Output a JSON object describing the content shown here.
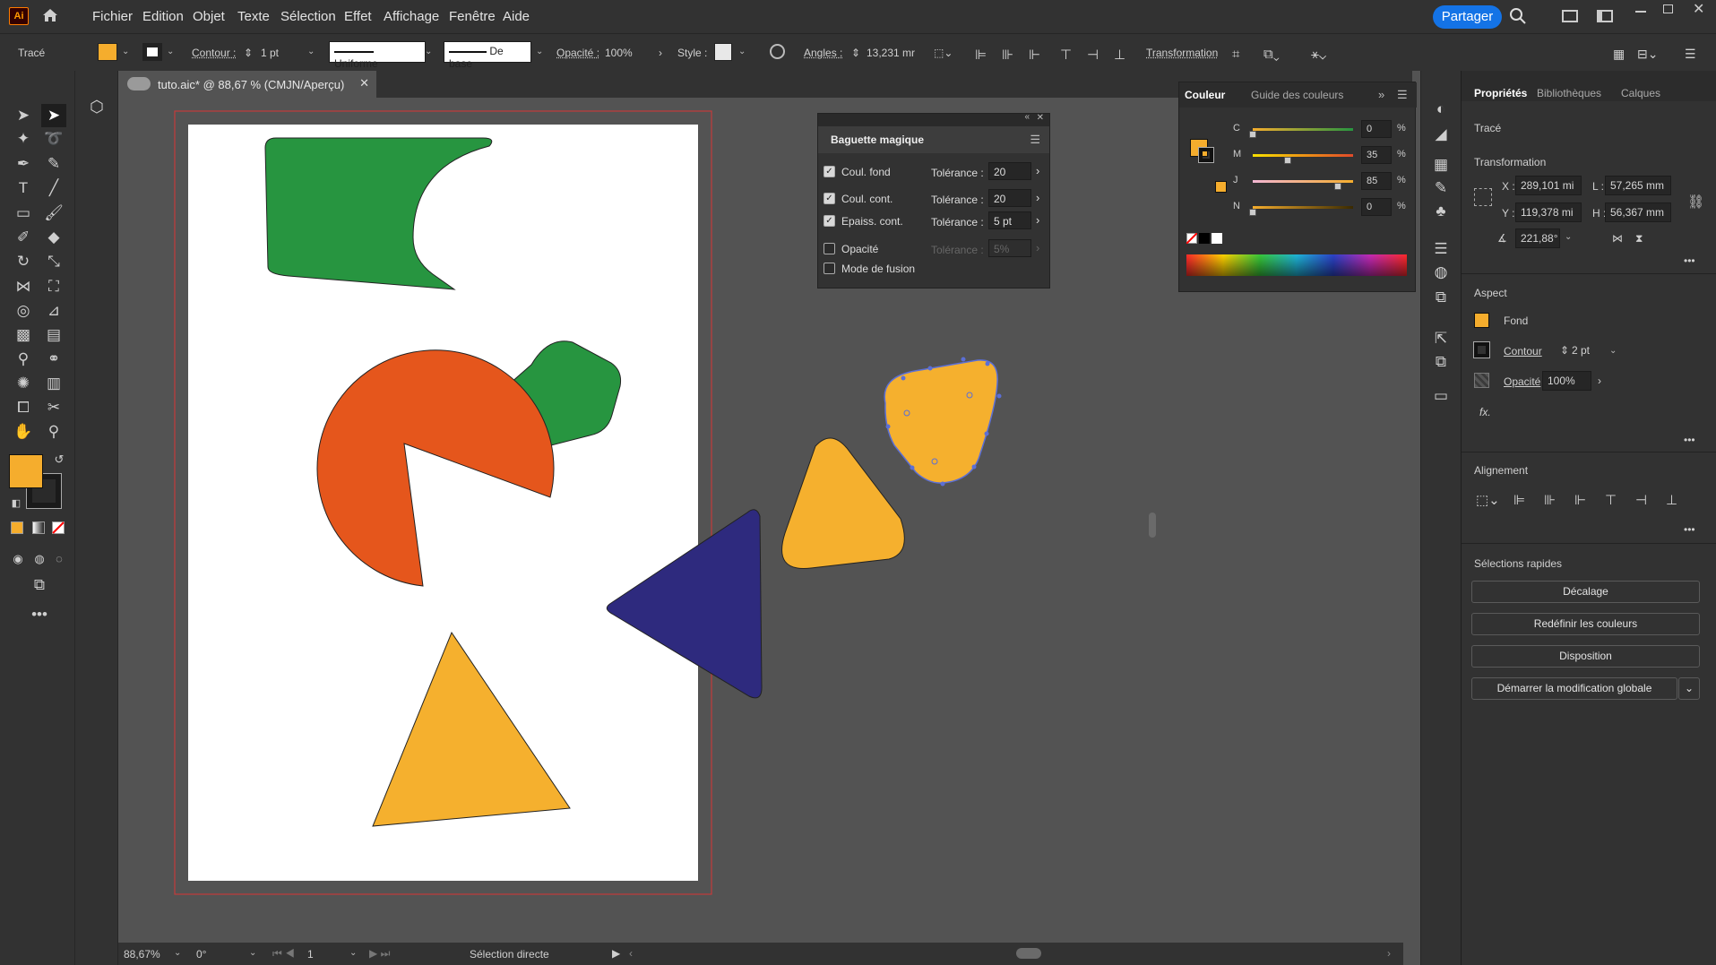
{
  "app": {
    "logo": "Ai",
    "share_label": "Partager"
  },
  "menu": [
    "Fichier",
    "Edition",
    "Objet",
    "Texte",
    "Sélection",
    "Effet",
    "Affichage",
    "Fenêtre",
    "Aide"
  ],
  "control": {
    "object_type": "Tracé",
    "contour_label": "Contour :",
    "stroke_weight": "1 pt",
    "profile": "Uniforme",
    "brush": "De base",
    "opacity_label": "Opacité :",
    "opacity_value": "100%",
    "style_label": "Style :",
    "angles_label": "Angles :",
    "angles_value": "13,231 mr",
    "transform_label": "Transformation",
    "fill_color": "#f5ad2d"
  },
  "doc": {
    "tab_title": "tuto.aic* @ 88,67 % (CMJN/Aperçu)"
  },
  "status": {
    "zoom": "88,67%",
    "rotation": "0°",
    "artboard": "1",
    "tool": "Sélection directe"
  },
  "magic_wand": {
    "title": "Baguette magique",
    "rows": [
      {
        "label": "Coul. fond",
        "checked": true,
        "tol_label": "Tolérance :",
        "tol": "20"
      },
      {
        "label": "Coul. cont.",
        "checked": true,
        "tol_label": "Tolérance :",
        "tol": "20"
      },
      {
        "label": "Epaiss. cont.",
        "checked": true,
        "tol_label": "Tolérance :",
        "tol": "5 pt"
      },
      {
        "label": "Opacité",
        "checked": false,
        "tol_label": "Tolérance :",
        "tol": "5%"
      },
      {
        "label": "Mode de fusion",
        "checked": false
      }
    ]
  },
  "color_panel": {
    "tabs": [
      "Couleur",
      "Guide des couleurs"
    ],
    "channels": [
      {
        "name": "C",
        "value": "0",
        "unit": "%",
        "level": 0.0
      },
      {
        "name": "M",
        "value": "35",
        "unit": "%",
        "level": 0.35
      },
      {
        "name": "J",
        "value": "85",
        "unit": "%",
        "level": 0.85
      },
      {
        "name": "N",
        "value": "0",
        "unit": "%",
        "level": 0.0
      }
    ]
  },
  "properties": {
    "tabs": [
      "Propriétés",
      "Bibliothèques",
      "Calques"
    ],
    "object": "Tracé",
    "transform_title": "Transformation",
    "x_label": "X :",
    "x": "289,101 mi",
    "y_label": "Y :",
    "y": "119,378 mi",
    "w_label": "L :",
    "w": "57,265 mm",
    "h_label": "H :",
    "h": "56,367 mm",
    "angle": "221,88°",
    "aspect_title": "Aspect",
    "fill_label": "Fond",
    "stroke_label": "Contour",
    "stroke_value": "2 pt",
    "opacity_label": "Opacité",
    "opacity_value": "100%",
    "fx": "fx.",
    "align_title": "Alignement",
    "quick_title": "Sélections rapides",
    "buttons": [
      "Décalage",
      "Redéfinir les couleurs",
      "Disposition",
      "Démarrer la modification globale"
    ]
  },
  "colors": {
    "green": "#279540",
    "orange_red": "#e5561c",
    "purple": "#2e2a7e",
    "yellow": "#f5b02e",
    "selection": "#5b6fd6"
  }
}
